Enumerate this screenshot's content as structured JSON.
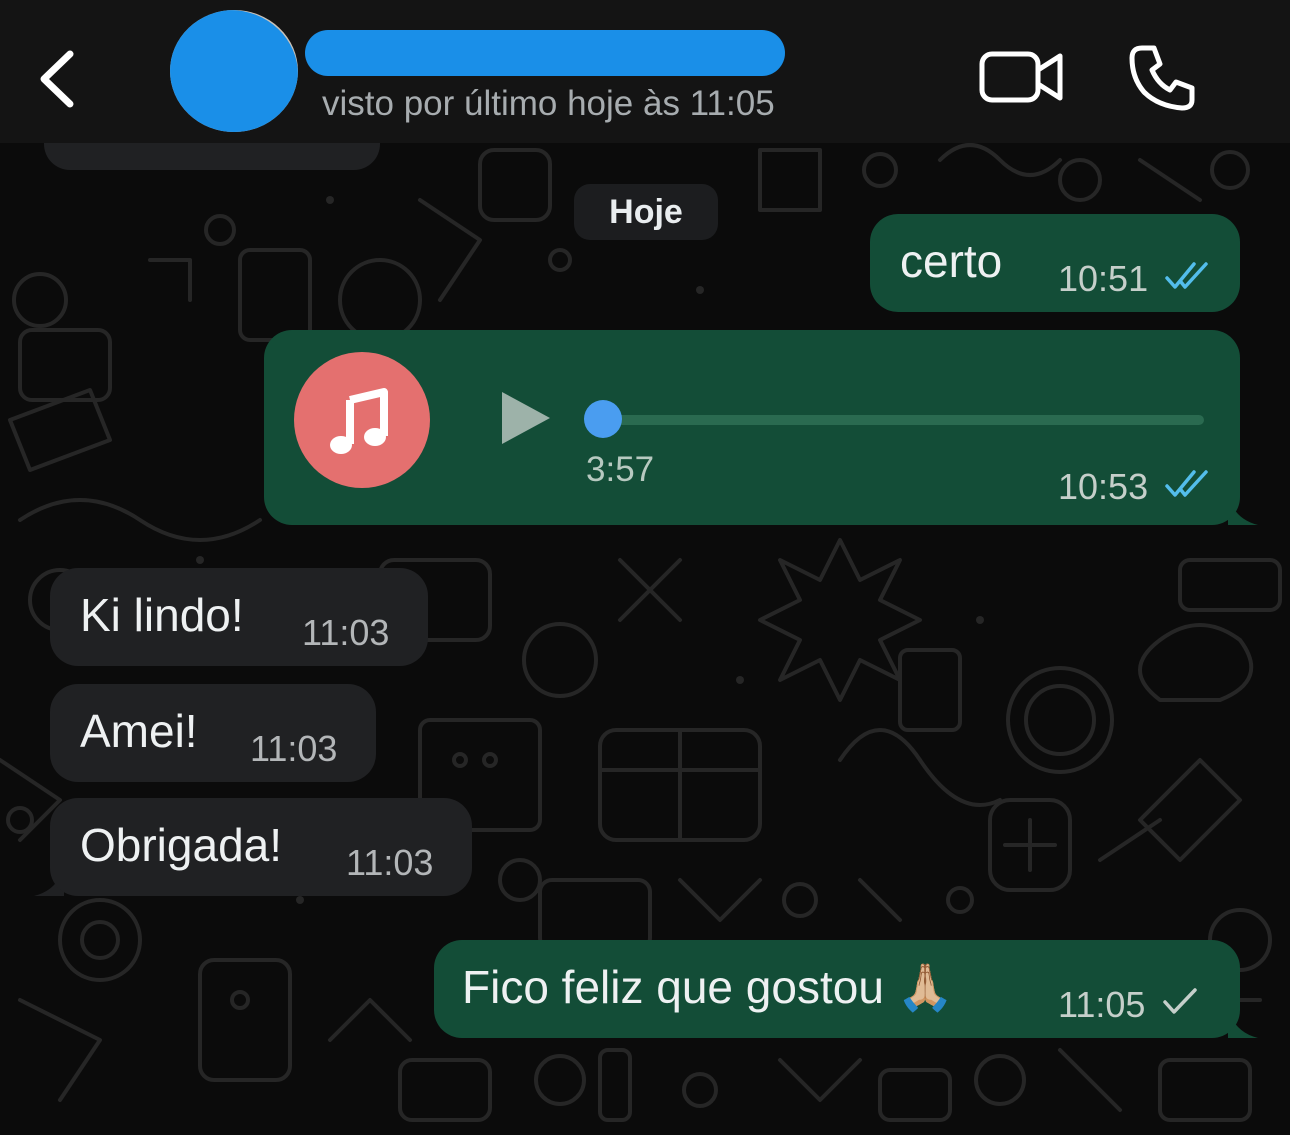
{
  "header": {
    "back_icon": "chevron-left-icon",
    "last_seen": "visto por último hoje às 11:05",
    "video_icon": "video-camera-icon",
    "call_icon": "phone-icon"
  },
  "date_separator": "Hoje",
  "messages": [
    {
      "direction": "out",
      "type": "text",
      "text": "certo",
      "time": "10:51",
      "status": "read"
    },
    {
      "direction": "out",
      "type": "audio",
      "icon": "music-note-icon",
      "duration": "3:57",
      "progress": 0,
      "time": "10:53",
      "status": "read"
    },
    {
      "direction": "in",
      "type": "text",
      "text": "Ki lindo!",
      "time": "11:03"
    },
    {
      "direction": "in",
      "type": "text",
      "text": "Amei!",
      "time": "11:03"
    },
    {
      "direction": "in",
      "type": "text",
      "text": "Obrigada!",
      "time": "11:03"
    },
    {
      "direction": "out",
      "type": "text",
      "text": "Fico feliz que gostou 🙏🏼",
      "time": "11:05",
      "status": "sent"
    }
  ],
  "colors": {
    "outgoing_bubble": "#134d37",
    "incoming_bubble": "#202123",
    "read_ticks": "#53bdeb",
    "sent_tick": "#c5cfca",
    "audio_icon_bg": "#e4706f",
    "progress_knob": "#4a9df0"
  }
}
